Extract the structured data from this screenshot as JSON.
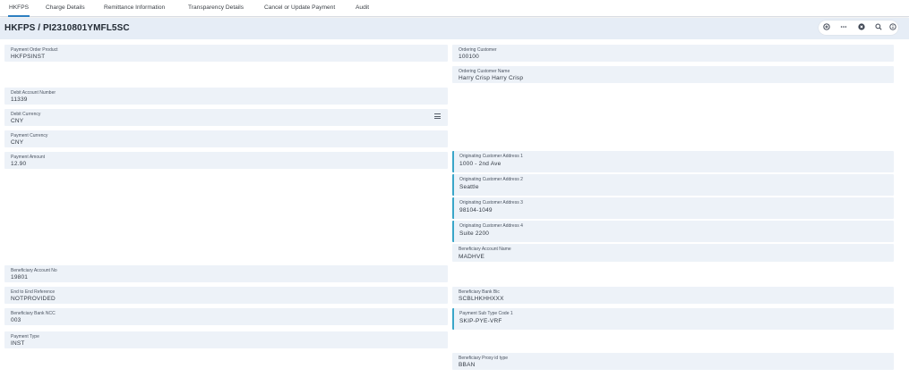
{
  "tabs": [
    {
      "label": "HKFPS",
      "active": true
    },
    {
      "label": "Charge Details",
      "active": false
    },
    {
      "label": "Remittance Information",
      "active": false
    },
    {
      "label": "Transparency Details",
      "active": false
    },
    {
      "label": "Cancel or Update Payment",
      "active": false
    },
    {
      "label": "Audit",
      "active": false
    }
  ],
  "header": {
    "title": "HKFPS / PI2310801YMFL5SC",
    "toolbar_icons": [
      "add-circle-icon",
      "more-icon",
      "close-circle-icon",
      "search-icon",
      "info-icon"
    ]
  },
  "left_fields": {
    "payment_order_product": {
      "label": "Payment Order Product",
      "value": "HKFPSINST"
    },
    "debit_account_number": {
      "label": "Debit Account Number",
      "value": "11339"
    },
    "debit_currency": {
      "label": "Debit Currency",
      "value": "CNY"
    },
    "payment_currency": {
      "label": "Payment Currency",
      "value": "CNY"
    },
    "payment_amount": {
      "label": "Payment Amount",
      "value": "12.90"
    },
    "beneficiary_account_no": {
      "label": "Beneficiary Account No",
      "value": "19801"
    },
    "end_to_end_reference": {
      "label": "End to End Reference",
      "value": "NOTPROVIDED"
    },
    "beneficiary_bank_ncc": {
      "label": "Beneficiary Bank NCC",
      "value": "003"
    },
    "payment_type": {
      "label": "Payment Type",
      "value": "INST"
    }
  },
  "right_fields": {
    "ordering_customer": {
      "label": "Ordering Customer",
      "value": "100100"
    },
    "ordering_customer_name": {
      "label": "Ordering Customer Name",
      "value": "Harry Crisp Harry Crisp"
    },
    "originating_address_1": {
      "label": "Originating Customer Address 1",
      "value": "1000 - 2nd Ave"
    },
    "originating_address_2": {
      "label": "Originating Customer Address 2",
      "value": "Seattle"
    },
    "originating_address_3": {
      "label": "Originating Customer Address 3",
      "value": "98104-1049"
    },
    "originating_address_4": {
      "label": "Originating Customer Address 4",
      "value": "Suite 2200"
    },
    "beneficiary_account_name": {
      "label": "Beneficiary Account Name",
      "value": "MADHVE"
    },
    "beneficiary_bank_bic": {
      "label": "Beneficiary Bank Bic",
      "value": "SCBLHKHHXXX"
    },
    "payment_sub_type_code_1": {
      "label": "Payment Sub Type Code 1",
      "value": "SKIP-PYE-VRF"
    },
    "beneficiary_proxy_id_type": {
      "label": "Beneficiary Proxy id type",
      "value": "BBAN"
    }
  },
  "colors": {
    "accent": "#2d7fc1",
    "field_bg": "#edf2f8",
    "field_accent_border": "#3aa6c9",
    "header_bg": "#e6edf6"
  }
}
